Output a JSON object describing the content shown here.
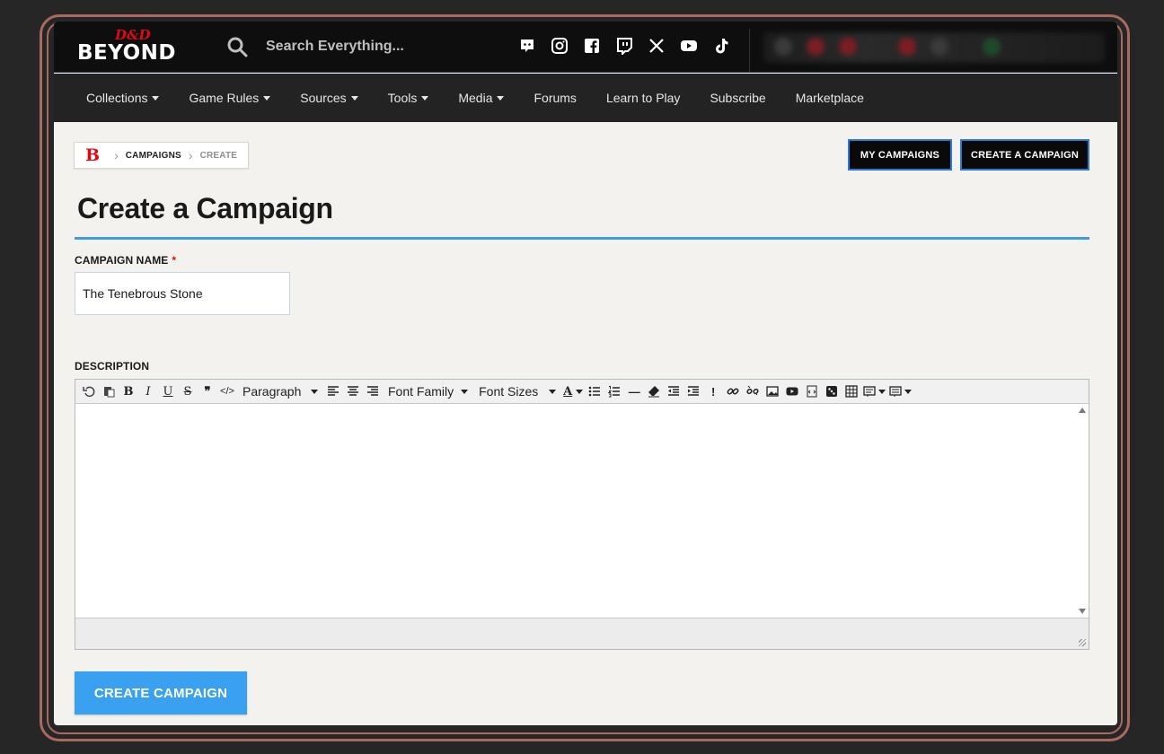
{
  "header": {
    "logo_top": "D&D",
    "logo_bottom": "BEYOND",
    "search_placeholder": "Search Everything...",
    "social_icons": [
      "discord-icon",
      "instagram-icon",
      "facebook-icon",
      "twitch-icon",
      "x-icon",
      "youtube-icon",
      "tiktok-icon"
    ]
  },
  "nav": {
    "items": [
      {
        "label": "Collections",
        "dropdown": true
      },
      {
        "label": "Game Rules",
        "dropdown": true
      },
      {
        "label": "Sources",
        "dropdown": true
      },
      {
        "label": "Tools",
        "dropdown": true
      },
      {
        "label": "Media",
        "dropdown": true
      },
      {
        "label": "Forums",
        "dropdown": false
      },
      {
        "label": "Learn to Play",
        "dropdown": false
      },
      {
        "label": "Subscribe",
        "dropdown": false
      },
      {
        "label": "Marketplace",
        "dropdown": false
      }
    ]
  },
  "breadcrumb": {
    "logo": "B",
    "campaigns": "CAMPAIGNS",
    "current": "CREATE"
  },
  "actions": {
    "my_campaigns": "MY CAMPAIGNS",
    "create_campaign": "CREATE A CAMPAIGN"
  },
  "page": {
    "title": "Create a Campaign"
  },
  "form": {
    "name_label": "CAMPAIGN NAME",
    "required_mark": "*",
    "name_value": "The Tenebrous Stone",
    "description_label": "DESCRIPTION",
    "submit_label": "CREATE CAMPAIGN"
  },
  "editor": {
    "paragraph": "Paragraph",
    "font_family": "Font Family",
    "font_sizes": "Font Sizes",
    "bold": "B",
    "italic": "I",
    "underline": "U",
    "strike": "S",
    "quote": "❞",
    "code": "</>",
    "font_color": "A",
    "hr": "—",
    "alert": "!"
  },
  "colors": {
    "accent_blue": "#3aa0f0",
    "rule_blue": "#3d9ee1",
    "brand_red": "#e40712",
    "frame": "#a86a5e"
  }
}
